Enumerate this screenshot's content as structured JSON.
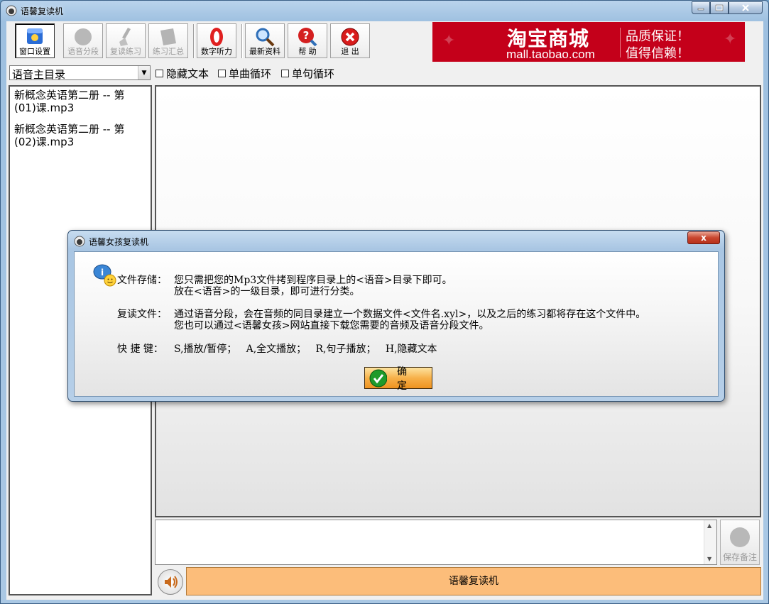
{
  "window": {
    "title": "语馨复读机",
    "controls": {
      "minimize": "minimize",
      "maximize": "maximize",
      "close": "close"
    }
  },
  "toolbar": {
    "buttons": [
      {
        "label": "窗口设置",
        "icon": "window-settings-icon",
        "enabled": true,
        "pressed": true
      },
      {
        "label": "语音分段",
        "icon": "speech-segment-icon",
        "enabled": false
      },
      {
        "label": "复读练习",
        "icon": "repeat-practice-icon",
        "enabled": false
      },
      {
        "label": "练习汇总",
        "icon": "practice-summary-icon",
        "enabled": false
      },
      {
        "label": "数字听力",
        "icon": "digit-listening-icon",
        "enabled": true
      },
      {
        "label": "最新资料",
        "icon": "latest-materials-icon",
        "enabled": true
      },
      {
        "label": "帮 助",
        "icon": "help-icon",
        "enabled": true
      },
      {
        "label": "退 出",
        "icon": "exit-icon",
        "enabled": true
      }
    ]
  },
  "banner": {
    "brand": "淘宝商城",
    "url": "mall.taobao.com",
    "slogan1": "品质保证！",
    "slogan2": "值得信赖！",
    "color": "#c4001a"
  },
  "directory": {
    "selected": "语音主目录"
  },
  "options": [
    {
      "label": "隐藏文本",
      "checked": false
    },
    {
      "label": "单曲循环",
      "checked": false
    },
    {
      "label": "单句循环",
      "checked": false
    }
  ],
  "files": [
    "新概念英语第二册 -- 第(01)课.mp3",
    "新概念英语第二册 -- 第(02)课.mp3"
  ],
  "save_note": {
    "label": "保存备注"
  },
  "status": {
    "text": "语馨复读机",
    "color": "#fcbd7a"
  },
  "dialog": {
    "title": "语馨女孩复读机",
    "rows": [
      {
        "key": "文件存储：",
        "lines": [
          "您只需把您的Mp3文件拷到程序目录上的<语音>目录下即可。",
          "放在<语音>的一级目录，即可进行分类。"
        ]
      },
      {
        "key": "复读文件：",
        "lines": [
          "通过语音分段，会在音频的同目录建立一个数据文件<文件名.xyl>，以及之后的练习都将存在这个文件中。",
          "您也可以通过<语馨女孩>网站直接下载您需要的音频及语音分段文件。"
        ]
      },
      {
        "key": "快 捷 键：",
        "lines": [
          "S,播放/暂停；   A,全文播放；   R,句子播放；   H,隐藏文本"
        ]
      }
    ],
    "ok_label": "确 定",
    "close_label": "x"
  }
}
